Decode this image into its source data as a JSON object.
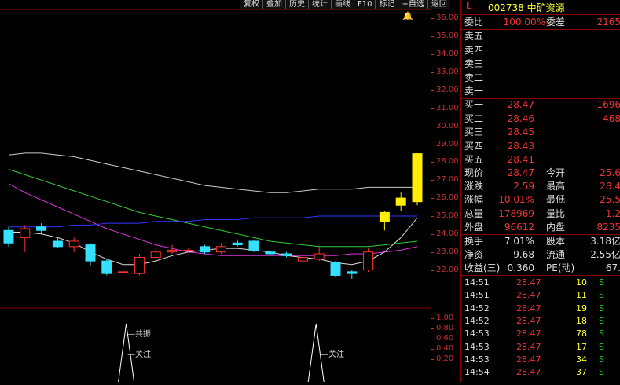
{
  "toolbar": [
    "复权",
    "叠加",
    "历史",
    "统计",
    "画线",
    "F10",
    "标记",
    "+自选",
    "返回"
  ],
  "price_axis": [
    "36.00",
    "35.00",
    "34.00",
    "33.00",
    "32.00",
    "31.00",
    "30.00",
    "29.00",
    "28.00",
    "27.00",
    "26.00",
    "25.00",
    "24.00",
    "23.00",
    "22.00"
  ],
  "indicator_axis": [
    "1.00",
    "0.80",
    "0.60",
    "0.40",
    "0.20"
  ],
  "indicator_labels": {
    "gongzhen": "共振",
    "guanzhu1": "关注",
    "guanzhu2": "关注"
  },
  "stock": {
    "l_tag": "L",
    "code": "002738 中矿资源"
  },
  "weibi": {
    "label": "委比",
    "value": "100.00%",
    "label2": "委差",
    "value2": "2165"
  },
  "sell": [
    {
      "label": "卖五",
      "price": "",
      "vol": ""
    },
    {
      "label": "卖四",
      "price": "",
      "vol": ""
    },
    {
      "label": "卖三",
      "price": "",
      "vol": ""
    },
    {
      "label": "卖二",
      "price": "",
      "vol": ""
    },
    {
      "label": "卖一",
      "price": "",
      "vol": ""
    }
  ],
  "buy": [
    {
      "label": "买一",
      "price": "28.47",
      "vol": "1696"
    },
    {
      "label": "买二",
      "price": "28.46",
      "vol": "468"
    },
    {
      "label": "买三",
      "price": "28.45",
      "vol": ""
    },
    {
      "label": "买四",
      "price": "28.43",
      "vol": ""
    },
    {
      "label": "买五",
      "price": "28.41",
      "vol": ""
    }
  ],
  "quote": [
    {
      "l1": "现价",
      "v1": "28.47",
      "l2": "今开",
      "v2": "25.6"
    },
    {
      "l1": "涨跌",
      "v1": "2.59",
      "l2": "最高",
      "v2": "28.4"
    },
    {
      "l1": "涨幅",
      "v1": "10.01%",
      "l2": "最低",
      "v2": "25.5"
    },
    {
      "l1": "总量",
      "v1": "178969",
      "l2": "量比",
      "v2": "1.2"
    },
    {
      "l1": "外盘",
      "v1": "96612",
      "l2": "内盘",
      "v2": "8235"
    }
  ],
  "fund": [
    {
      "l1": "换手",
      "v1": "7.01%",
      "l2": "股本",
      "v2": "3.18亿"
    },
    {
      "l1": "净资",
      "v1": "9.68",
      "l2": "流通",
      "v2": "2.55亿"
    },
    {
      "l1": "收益(三)",
      "v1": "0.360",
      "l2": "PE(动)",
      "v2": "67."
    }
  ],
  "ticks": [
    {
      "t": "14:51",
      "p": "28.47",
      "v": "10",
      "s": "S"
    },
    {
      "t": "14:51",
      "p": "28.47",
      "v": "11",
      "s": "S"
    },
    {
      "t": "14:52",
      "p": "28.47",
      "v": "19",
      "s": "S"
    },
    {
      "t": "14:52",
      "p": "28.47",
      "v": "18",
      "s": "S"
    },
    {
      "t": "14:53",
      "p": "28.47",
      "v": "78",
      "s": "S"
    },
    {
      "t": "14:53",
      "p": "28.47",
      "v": "17",
      "s": "S"
    },
    {
      "t": "14:53",
      "p": "28.47",
      "v": "34",
      "s": "S"
    },
    {
      "t": "14:54",
      "p": "28.47",
      "v": "37",
      "s": "S"
    }
  ],
  "chart_data": {
    "type": "candlestick",
    "ylim": [
      21.5,
      36.5
    ],
    "candles": [
      {
        "o": 24.2,
        "c": 23.5,
        "h": 24.4,
        "l": 23.3
      },
      {
        "o": 23.8,
        "c": 24.3,
        "h": 24.5,
        "l": 23.0
      },
      {
        "o": 24.4,
        "c": 24.2,
        "h": 24.6,
        "l": 24.0
      },
      {
        "o": 23.6,
        "c": 23.3,
        "h": 23.8,
        "l": 23.2
      },
      {
        "o": 23.3,
        "c": 23.6,
        "h": 23.8,
        "l": 23.0
      },
      {
        "o": 23.4,
        "c": 22.5,
        "h": 23.5,
        "l": 22.2
      },
      {
        "o": 22.5,
        "c": 21.8,
        "h": 22.6,
        "l": 21.7
      },
      {
        "o": 21.9,
        "c": 21.9,
        "h": 22.1,
        "l": 21.7
      },
      {
        "o": 21.8,
        "c": 22.7,
        "h": 22.9,
        "l": 21.7
      },
      {
        "o": 22.7,
        "c": 23.0,
        "h": 23.2,
        "l": 22.6
      },
      {
        "o": 23.0,
        "c": 23.1,
        "h": 23.4,
        "l": 22.9
      },
      {
        "o": 23.1,
        "c": 23.1,
        "h": 23.2,
        "l": 23.0
      },
      {
        "o": 23.3,
        "c": 23.0,
        "h": 23.4,
        "l": 22.9
      },
      {
        "o": 23.0,
        "c": 23.3,
        "h": 23.5,
        "l": 22.9
      },
      {
        "o": 23.5,
        "c": 23.4,
        "h": 23.7,
        "l": 23.3
      },
      {
        "o": 23.6,
        "c": 23.1,
        "h": 23.7,
        "l": 23.0
      },
      {
        "o": 23.0,
        "c": 22.9,
        "h": 23.1,
        "l": 22.8
      },
      {
        "o": 22.9,
        "c": 22.8,
        "h": 23.0,
        "l": 22.7
      },
      {
        "o": 22.5,
        "c": 22.7,
        "h": 22.9,
        "l": 22.4
      },
      {
        "o": 22.6,
        "c": 22.9,
        "h": 23.3,
        "l": 22.5
      },
      {
        "o": 22.4,
        "c": 21.7,
        "h": 22.5,
        "l": 21.6
      },
      {
        "o": 21.9,
        "c": 21.8,
        "h": 22.0,
        "l": 21.5
      },
      {
        "o": 22.0,
        "c": 23.0,
        "h": 23.2,
        "l": 21.9
      },
      {
        "o": 24.7,
        "c": 25.2,
        "h": 25.3,
        "l": 24.2
      },
      {
        "o": 25.6,
        "c": 26.0,
        "h": 26.3,
        "l": 25.3
      },
      {
        "o": 25.8,
        "c": 28.47,
        "h": 28.5,
        "l": 25.6
      }
    ],
    "ma_series": [
      {
        "color": "#cccccc",
        "values": [
          28.4,
          28.5,
          28.5,
          28.4,
          28.3,
          28.1,
          27.9,
          27.7,
          27.5,
          27.3,
          27.1,
          26.9,
          26.7,
          26.6,
          26.5,
          26.4,
          26.3,
          26.3,
          26.4,
          26.5,
          26.5,
          26.5,
          26.6,
          26.6,
          26.6,
          26.6
        ]
      },
      {
        "color": "#33cc33",
        "values": [
          27.6,
          27.3,
          27.0,
          26.7,
          26.4,
          26.1,
          25.8,
          25.5,
          25.2,
          25.0,
          24.8,
          24.6,
          24.4,
          24.2,
          24.0,
          23.8,
          23.6,
          23.5,
          23.4,
          23.3,
          23.3,
          23.3,
          23.3,
          23.4,
          23.5,
          23.6
        ]
      },
      {
        "color": "#dd33dd",
        "values": [
          26.8,
          26.3,
          25.9,
          25.5,
          25.1,
          24.7,
          24.3,
          24.0,
          23.7,
          23.4,
          23.2,
          23.0,
          22.9,
          22.8,
          22.8,
          22.8,
          22.8,
          22.8,
          22.8,
          22.8,
          22.8,
          22.9,
          22.9,
          23.0,
          23.1,
          23.3
        ]
      },
      {
        "color": "#dddddd",
        "values": [
          24.1,
          24.1,
          24.0,
          23.8,
          23.5,
          23.0,
          22.6,
          22.3,
          22.3,
          22.5,
          22.8,
          23.0,
          23.1,
          23.2,
          23.2,
          23.1,
          23.0,
          22.8,
          22.7,
          22.6,
          22.4,
          22.3,
          22.5,
          23.0,
          23.8,
          24.9
        ]
      },
      {
        "color": "#3333ff",
        "values": [
          24.4,
          24.4,
          24.4,
          24.4,
          24.5,
          24.5,
          24.6,
          24.6,
          24.6,
          24.7,
          24.7,
          24.7,
          24.8,
          24.8,
          24.8,
          24.9,
          24.9,
          24.9,
          24.9,
          25.0,
          25.0,
          25.0,
          25.0,
          25.0,
          25.0,
          25.0
        ]
      }
    ],
    "indicator": [
      0,
      0,
      0,
      0,
      0,
      0,
      0,
      1,
      0,
      0,
      0,
      0,
      0,
      0,
      0,
      0,
      0,
      0,
      0,
      1,
      0,
      0,
      0,
      0,
      0,
      0
    ]
  }
}
